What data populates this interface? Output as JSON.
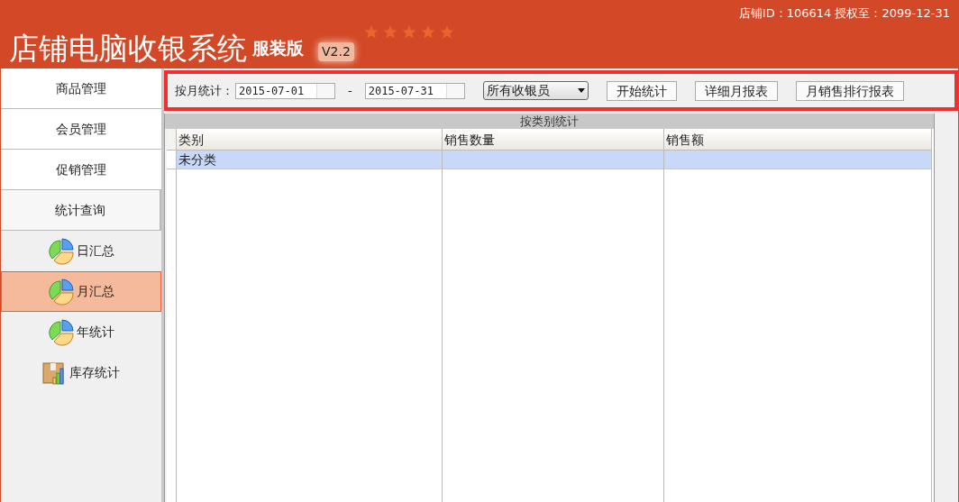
{
  "header": {
    "title": "店铺电脑收银系统",
    "edition": "服装版",
    "version": "V2.2",
    "store_info": "店铺ID：106614 授权至：2099-12-31"
  },
  "sidebar": {
    "sections": [
      {
        "label": "商品管理",
        "selected": false
      },
      {
        "label": "会员管理",
        "selected": false
      },
      {
        "label": "促销管理",
        "selected": false
      },
      {
        "label": "统计查询",
        "selected": true
      }
    ],
    "items": [
      {
        "label": "日汇总",
        "kind": "pie",
        "selected": false
      },
      {
        "label": "月汇总",
        "kind": "pie",
        "selected": true
      },
      {
        "label": "年统计",
        "kind": "pie",
        "selected": false
      },
      {
        "label": "库存统计",
        "kind": "box",
        "selected": false
      }
    ]
  },
  "toolbar": {
    "label": "按月统计：",
    "start_date": "2015-07-01",
    "separator": "-",
    "end_date": "2015-07-31",
    "cashier": "所有收银员",
    "buttons": [
      "开始统计",
      "详细月报表",
      "月销售排行报表"
    ]
  },
  "table": {
    "title": "按类别统计",
    "columns": [
      "类别",
      "销售数量",
      "销售额"
    ],
    "rows": [
      {
        "cells": [
          "未分类",
          "",
          ""
        ],
        "selected": true
      }
    ]
  }
}
